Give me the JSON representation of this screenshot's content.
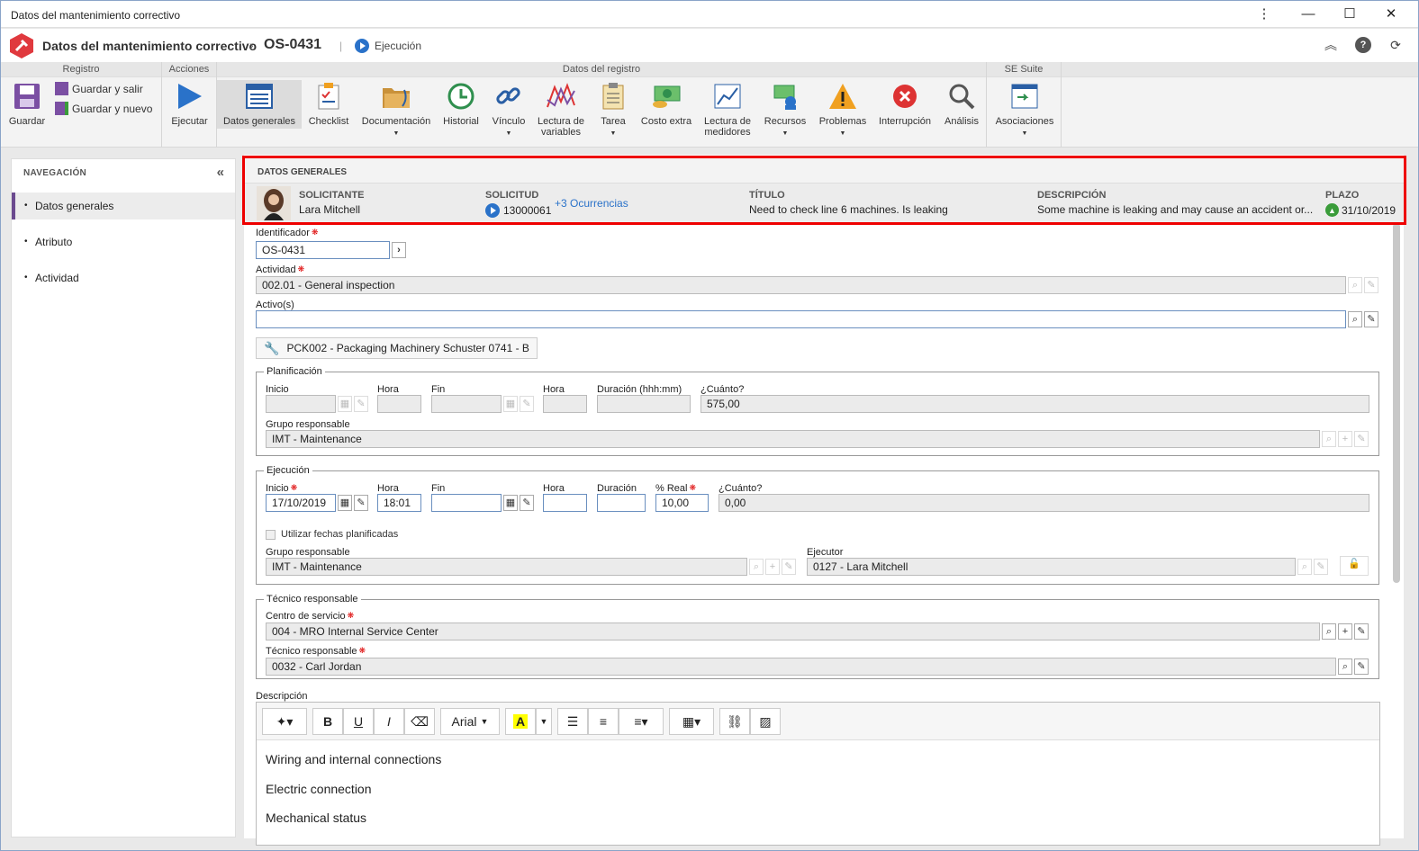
{
  "window": {
    "title": "Datos del mantenimiento correctivo"
  },
  "header": {
    "title": "Datos del mantenimiento correctivo",
    "separator": "›",
    "code": "OS-0431",
    "bar": "|",
    "status": "Ejecución"
  },
  "ribbon": {
    "groups": {
      "registro": "Registro",
      "acciones": "Acciones",
      "datos": "Datos del registro",
      "suite": "SE Suite"
    },
    "guardar": "Guardar",
    "guardar_salir": "Guardar y salir",
    "guardar_nuevo": "Guardar y nuevo",
    "ejecutar": "Ejecutar",
    "datos_generales": "Datos generales",
    "checklist": "Checklist",
    "documentacion": "Documentación",
    "historial": "Historial",
    "vinculo": "Vínculo",
    "lectura_variables_1": "Lectura de",
    "lectura_variables_2": "variables",
    "tarea": "Tarea",
    "costo_extra": "Costo extra",
    "lectura_medidores_1": "Lectura de",
    "lectura_medidores_2": "medidores",
    "recursos": "Recursos",
    "problemas": "Problemas",
    "interrupcion": "Interrupción",
    "analisis": "Análisis",
    "asociaciones": "Asociaciones"
  },
  "nav": {
    "title": "NAVEGACIÓN",
    "items": [
      "Datos generales",
      "Atributo",
      "Actividad"
    ]
  },
  "summary": {
    "heading": "DATOS GENERALES",
    "solicitante_l": "SOLICITANTE",
    "solicitante_v": "Lara Mitchell",
    "solicitud_l": "SOLICITUD",
    "solicitud_v": "13000061",
    "ocurrencias": "+3 Ocurrencias",
    "titulo_l": "TÍTULO",
    "titulo_v": "Need to check line 6 machines. Is leaking",
    "descripcion_l": "DESCRIPCIÓN",
    "descripcion_v": "Some machine is leaking and may cause an accident or...",
    "plazo_l": "PLAZO",
    "plazo_v": "31/10/2019"
  },
  "form": {
    "identificador_l": "Identificador",
    "identificador_v": "OS-0431",
    "actividad_l": "Actividad",
    "actividad_v": "002.01 - General inspection",
    "activos_l": "Activo(s)",
    "activo_chip": "PCK002 - Packaging Machinery Schuster 0741 - B",
    "planificacion": {
      "legend": "Planificación",
      "inicio": "Inicio",
      "hora": "Hora",
      "fin": "Fin",
      "hora2": "Hora",
      "duracion": "Duración (hhh:mm)",
      "cuanto": "¿Cuánto?",
      "cuanto_v": "575,00",
      "grupo_l": "Grupo responsable",
      "grupo_v": "IMT - Maintenance"
    },
    "ejecucion": {
      "legend": "Ejecución",
      "inicio": "Inicio",
      "inicio_v": "17/10/2019",
      "hora": "Hora",
      "hora_v": "18:01",
      "fin": "Fin",
      "hora2": "Hora",
      "duracion": "Duración",
      "real": "% Real",
      "real_v": "10,00",
      "cuanto": "¿Cuánto?",
      "cuanto_v": "0,00",
      "utilizar": "Utilizar fechas planificadas",
      "grupo_l": "Grupo responsable",
      "grupo_v": "IMT - Maintenance",
      "ejecutor_l": "Ejecutor",
      "ejecutor_v": "0127 - Lara Mitchell"
    },
    "tecnico": {
      "legend": "Técnico responsable",
      "centro_l": "Centro de servicio",
      "centro_v": "004 - MRO Internal Service Center",
      "tecnico_l": "Técnico responsable",
      "tecnico_v": "0032 - Carl Jordan"
    },
    "descripcion_l": "Descripción",
    "editor": {
      "font": "Arial",
      "lines": [
        "Wiring and internal connections",
        "Electric connection",
        "Mechanical status"
      ]
    }
  }
}
